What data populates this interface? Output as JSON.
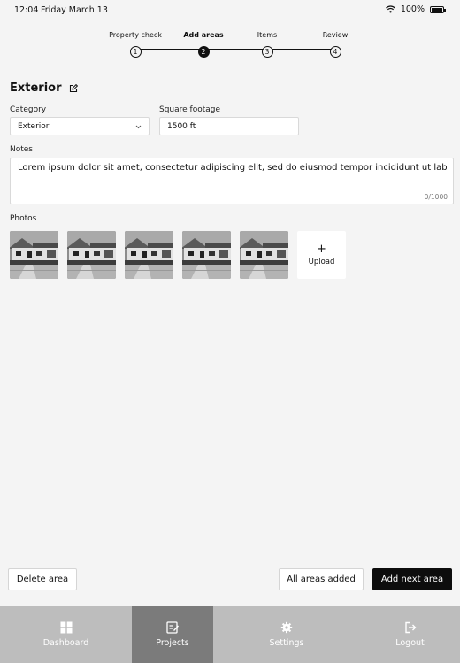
{
  "status": {
    "time": "12:04",
    "date": "Friday March 13",
    "battery": "100%"
  },
  "stepper": {
    "steps": [
      {
        "label": "Property check",
        "num": "1"
      },
      {
        "label": "Add areas",
        "num": "2"
      },
      {
        "label": "Items",
        "num": "3"
      },
      {
        "label": "Review",
        "num": "4"
      }
    ],
    "active_index": 1
  },
  "section": {
    "title": "Exterior"
  },
  "form": {
    "category_label": "Category",
    "category_value": "Exterior",
    "sqft_label": "Square footage",
    "sqft_value": "1500 ft",
    "notes_label": "Notes",
    "notes_value": "Lorem ipsum dolor sit amet, consectetur adipiscing elit, sed do eiusmod tempor incididunt ut labore...",
    "notes_count": "0/1000"
  },
  "photos": {
    "label": "Photos",
    "count": 5,
    "upload_label": "Upload",
    "upload_plus": "+"
  },
  "actions": {
    "delete": "Delete area",
    "all_added": "All areas added",
    "add_next": "Add next area"
  },
  "nav": {
    "dashboard": "Dashboard",
    "projects": "Projects",
    "settings": "Settings",
    "logout": "Logout"
  }
}
